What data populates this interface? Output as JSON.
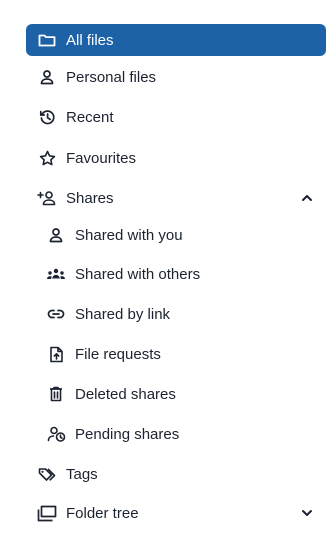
{
  "nav": {
    "all_files": "All files",
    "personal_files": "Personal files",
    "recent": "Recent",
    "favourites": "Favourites",
    "shares": "Shares",
    "shared_with_you": "Shared with you",
    "shared_with_others": "Shared with others",
    "shared_by_link": "Shared by link",
    "file_requests": "File requests",
    "deleted_shares": "Deleted shares",
    "pending_shares": "Pending shares",
    "tags": "Tags",
    "folder_tree": "Folder tree"
  },
  "state": {
    "active_item": "all-files",
    "shares_expanded": true,
    "folder_tree_expanded": false
  },
  "icons": {
    "all_files": "folder-icon",
    "personal_files": "person-icon",
    "recent": "history-icon",
    "favourites": "star-icon",
    "shares": "add-user-icon",
    "shared_with_you": "person-icon",
    "shared_with_others": "group-icon",
    "shared_by_link": "link-icon",
    "file_requests": "file-upload-icon",
    "deleted_shares": "trash-icon",
    "pending_shares": "pending-user-icon",
    "tags": "tag-icon",
    "folder_tree": "folder-tree-icon"
  },
  "colors": {
    "active_bg": "#1d62a7",
    "active_text": "#ffffff",
    "text": "#1c2330"
  }
}
